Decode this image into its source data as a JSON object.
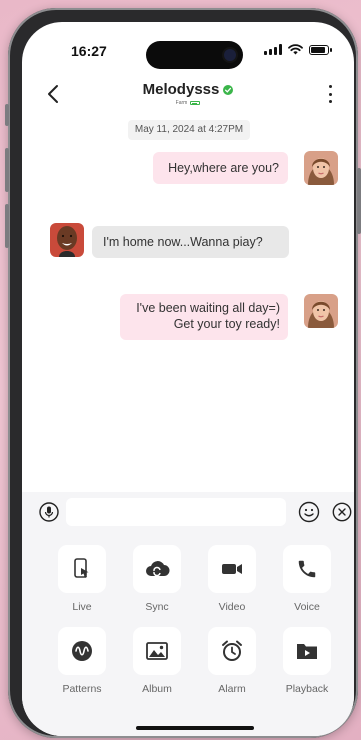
{
  "status_bar": {
    "time": "16:27"
  },
  "header": {
    "contact_name": "Melodysss",
    "sub_label": "Farm"
  },
  "chat": {
    "timestamp": "May 11, 2024 at 4:27PM",
    "messages": [
      {
        "direction": "outgoing",
        "lines": [
          "Hey,where are you?"
        ]
      },
      {
        "direction": "incoming",
        "lines": [
          "I'm home now...Wanna piay?"
        ]
      },
      {
        "direction": "outgoing",
        "lines": [
          "I've been waiting all day=)",
          "Get your toy ready!"
        ]
      }
    ]
  },
  "composer": {
    "value": "",
    "placeholder": ""
  },
  "tools": [
    {
      "label": "Live",
      "icon": "phone-touch-icon"
    },
    {
      "label": "Sync",
      "icon": "cloud-sync-icon"
    },
    {
      "label": "Video",
      "icon": "video-camera-icon"
    },
    {
      "label": "Voice",
      "icon": "phone-call-icon"
    },
    {
      "label": "Patterns",
      "icon": "wave-pattern-icon"
    },
    {
      "label": "Album",
      "icon": "image-icon"
    },
    {
      "label": "Alarm",
      "icon": "alarm-clock-icon"
    },
    {
      "label": "Playback",
      "icon": "folder-play-icon"
    }
  ],
  "colors": {
    "outgoing_bubble": "#fde4ec",
    "incoming_bubble": "#e8e8e8",
    "verified": "#3bb54a",
    "panel_bg": "#f5f5f7"
  }
}
